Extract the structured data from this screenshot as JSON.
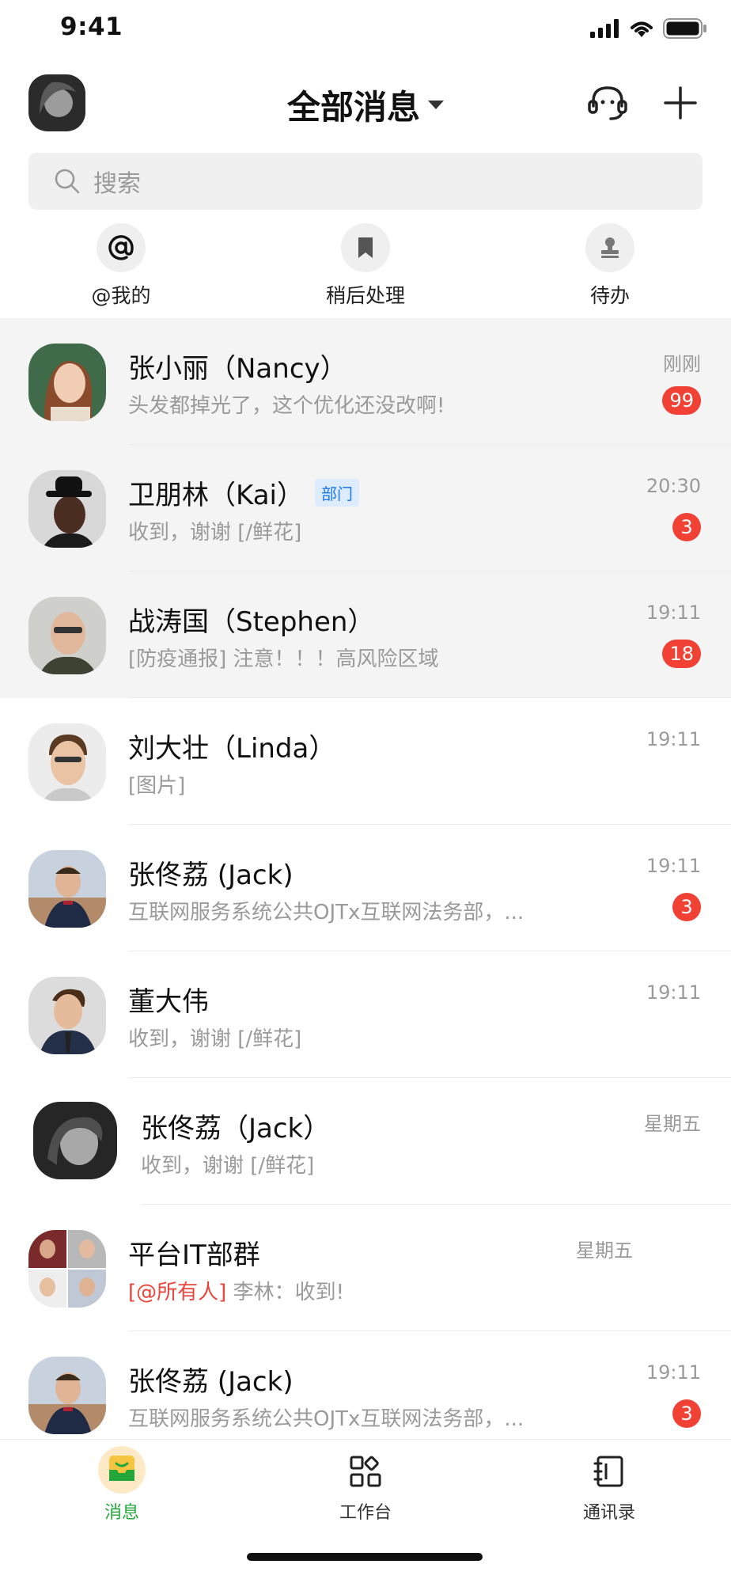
{
  "status_bar": {
    "time": "9:41"
  },
  "header": {
    "title": "全部消息"
  },
  "search": {
    "placeholder": "搜索"
  },
  "quick_actions": [
    {
      "label": "@我的",
      "icon": "at-icon"
    },
    {
      "label": "稍后处理",
      "icon": "bookmark-icon"
    },
    {
      "label": "待办",
      "icon": "stamp-icon"
    }
  ],
  "conversations": [
    {
      "name": "张小丽（Nancy）",
      "preview": "头发都掉光了，这个优化还没改啊!",
      "time": "刚刚",
      "badge": "99"
    },
    {
      "name": "卫朋林（Kai）",
      "tag": "部门",
      "preview": "收到，谢谢 [/鲜花]",
      "time": "20:30",
      "badge": "3"
    },
    {
      "name": "战涛国（Stephen）",
      "preview": "[防疫通报] 注意！！！高风险区域",
      "time": "19:11",
      "badge": "18"
    },
    {
      "name": "刘大壮（Linda）",
      "preview": "[图片]",
      "time": "19:11"
    },
    {
      "name": "张佟荔 (Jack)",
      "preview": "互联网服务系统公共OJTx互联网法务部，...",
      "time": "19:11",
      "badge": "3"
    },
    {
      "name": "董大伟",
      "preview": "收到，谢谢 [/鲜花]",
      "time": "19:11"
    },
    {
      "name": "张佟荔（Jack）",
      "preview": "收到，谢谢 [/鲜花]",
      "time": "星期五"
    },
    {
      "name": "平台IT部群",
      "mention": "[@所有人]",
      "preview": "李林：收到!",
      "time": "星期五"
    },
    {
      "name": "张佟荔 (Jack)",
      "preview": "互联网服务系统公共OJTx互联网法务部，...",
      "time": "19:11",
      "badge": "3"
    }
  ],
  "tabbar": [
    {
      "label": "消息",
      "active": true
    },
    {
      "label": "工作台"
    },
    {
      "label": "通讯录"
    }
  ],
  "colors": {
    "accent_green": "#23a73a",
    "badge_red": "#f04134",
    "tag_blue": "#1a78e8"
  }
}
